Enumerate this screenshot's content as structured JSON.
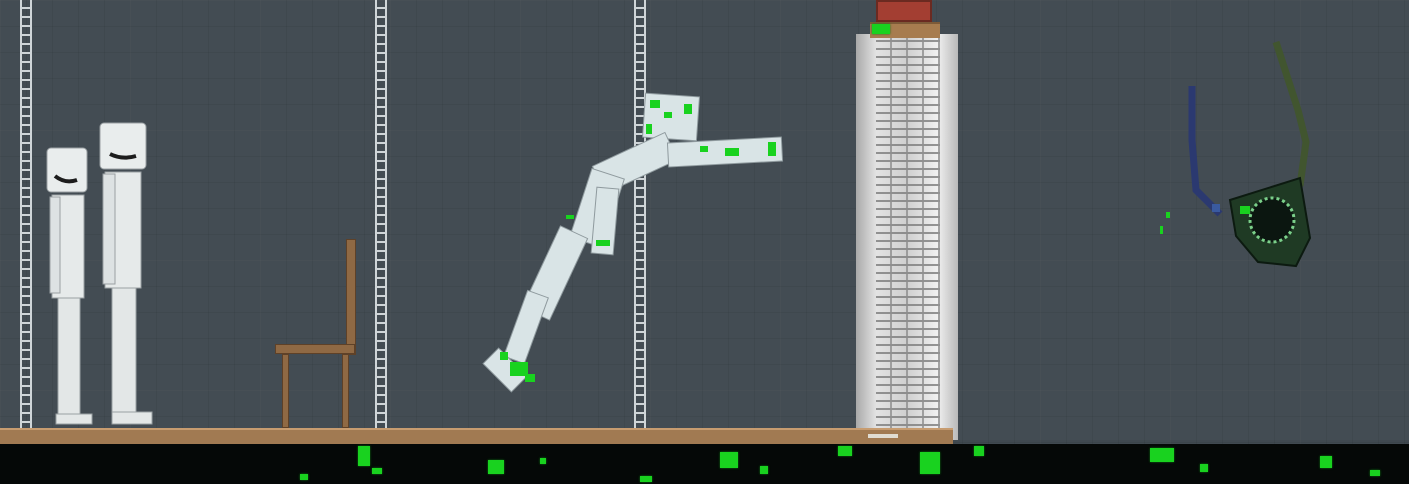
{
  "scene": {
    "game": "",
    "background_color": "#404950",
    "floor_color": "#a17a52",
    "goo_color": "#19d21f",
    "ground_color": "#050807"
  },
  "entities": [
    {
      "name": "human-ragdoll-left",
      "kind": "human",
      "state": "standing"
    },
    {
      "name": "human-ragdoll-right",
      "kind": "human",
      "state": "standing"
    },
    {
      "name": "chair",
      "kind": "furniture"
    },
    {
      "name": "human-ragdoll-jumping",
      "kind": "human",
      "state": "infected"
    },
    {
      "name": "stacked-tower",
      "kind": "structure"
    },
    {
      "name": "crate",
      "kind": "object"
    },
    {
      "name": "creature",
      "kind": "creature",
      "color": "#2a6a34"
    }
  ],
  "ladders": [
    {
      "name": "ladder-1"
    },
    {
      "name": "ladder-2"
    },
    {
      "name": "ladder-3"
    }
  ]
}
